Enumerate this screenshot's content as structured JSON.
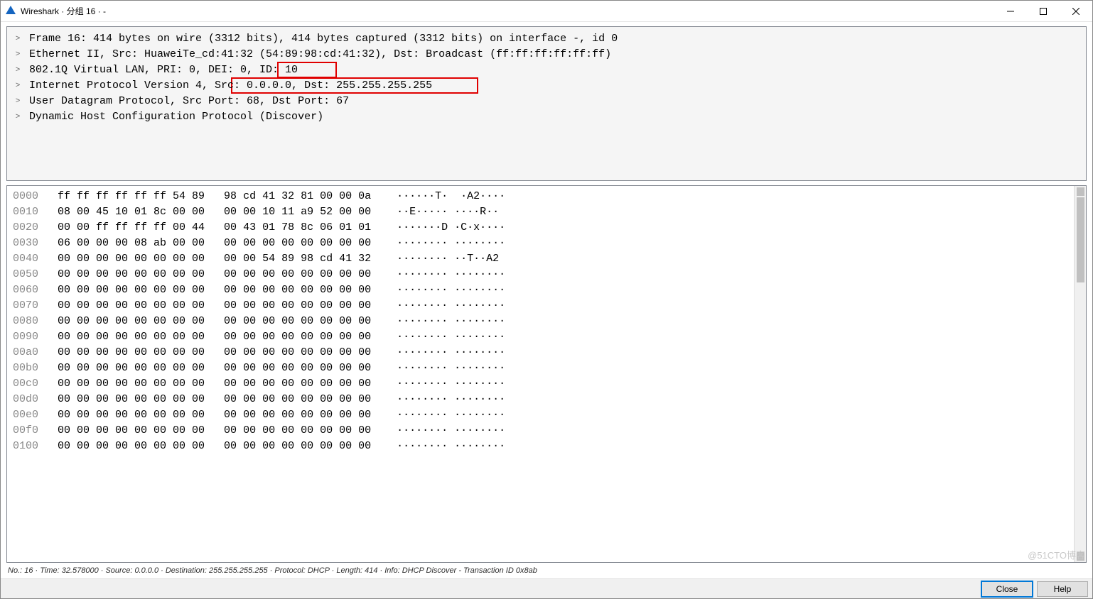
{
  "window": {
    "title": "Wireshark · 分组 16 · -"
  },
  "details": {
    "rows": [
      "Frame 16: 414 bytes on wire (3312 bits), 414 bytes captured (3312 bits) on interface -, id 0",
      "Ethernet II, Src: HuaweiTe_cd:41:32 (54:89:98:cd:41:32), Dst: Broadcast (ff:ff:ff:ff:ff:ff)",
      "802.1Q Virtual LAN, PRI: 0, DEI: 0, ID: 10",
      "Internet Protocol Version 4, Src: 0.0.0.0, Dst: 255.255.255.255",
      "User Datagram Protocol, Src Port: 68, Dst Port: 67",
      "Dynamic Host Configuration Protocol (Discover)"
    ]
  },
  "highlights": [
    {
      "text": "ID: 10",
      "row": 2
    },
    {
      "text": "Src: 0.0.0.0, Dst: 255.255.255.255",
      "row": 3
    }
  ],
  "hex": {
    "lines": [
      {
        "off": "0000",
        "hex": "ff ff ff ff ff ff 54 89   98 cd 41 32 81 00 00 0a",
        "asc": "······T·  ·A2····"
      },
      {
        "off": "0010",
        "hex": "08 00 45 10 01 8c 00 00   00 00 10 11 a9 52 00 00",
        "asc": "··E····· ····R··"
      },
      {
        "off": "0020",
        "hex": "00 00 ff ff ff ff 00 44   00 43 01 78 8c 06 01 01",
        "asc": "·······D ·C·x····"
      },
      {
        "off": "0030",
        "hex": "06 00 00 00 08 ab 00 00   00 00 00 00 00 00 00 00",
        "asc": "········ ········"
      },
      {
        "off": "0040",
        "hex": "00 00 00 00 00 00 00 00   00 00 54 89 98 cd 41 32",
        "asc": "········ ··T··A2"
      },
      {
        "off": "0050",
        "hex": "00 00 00 00 00 00 00 00   00 00 00 00 00 00 00 00",
        "asc": "········ ········"
      },
      {
        "off": "0060",
        "hex": "00 00 00 00 00 00 00 00   00 00 00 00 00 00 00 00",
        "asc": "········ ········"
      },
      {
        "off": "0070",
        "hex": "00 00 00 00 00 00 00 00   00 00 00 00 00 00 00 00",
        "asc": "········ ········"
      },
      {
        "off": "0080",
        "hex": "00 00 00 00 00 00 00 00   00 00 00 00 00 00 00 00",
        "asc": "········ ········"
      },
      {
        "off": "0090",
        "hex": "00 00 00 00 00 00 00 00   00 00 00 00 00 00 00 00",
        "asc": "········ ········"
      },
      {
        "off": "00a0",
        "hex": "00 00 00 00 00 00 00 00   00 00 00 00 00 00 00 00",
        "asc": "········ ········"
      },
      {
        "off": "00b0",
        "hex": "00 00 00 00 00 00 00 00   00 00 00 00 00 00 00 00",
        "asc": "········ ········"
      },
      {
        "off": "00c0",
        "hex": "00 00 00 00 00 00 00 00   00 00 00 00 00 00 00 00",
        "asc": "········ ········"
      },
      {
        "off": "00d0",
        "hex": "00 00 00 00 00 00 00 00   00 00 00 00 00 00 00 00",
        "asc": "········ ········"
      },
      {
        "off": "00e0",
        "hex": "00 00 00 00 00 00 00 00   00 00 00 00 00 00 00 00",
        "asc": "········ ········"
      },
      {
        "off": "00f0",
        "hex": "00 00 00 00 00 00 00 00   00 00 00 00 00 00 00 00",
        "asc": "········ ········"
      },
      {
        "off": "0100",
        "hex": "00 00 00 00 00 00 00 00   00 00 00 00 00 00 00 00",
        "asc": "········ ········"
      }
    ]
  },
  "status": {
    "text": "No.: 16 · Time: 32.578000 · Source: 0.0.0.0 · Destination: 255.255.255.255 · Protocol: DHCP · Length: 414 · Info: DHCP Discover - Transaction ID 0x8ab"
  },
  "buttons": {
    "close": "Close",
    "help": "Help"
  },
  "watermark": "@51CTO博客"
}
